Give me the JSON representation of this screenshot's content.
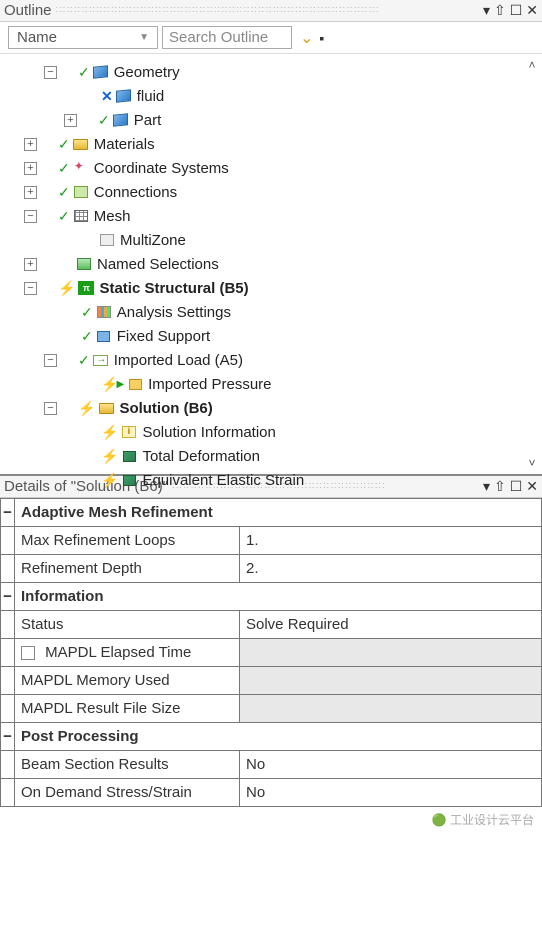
{
  "outline": {
    "title": "Outline",
    "filter_dropdown": "Name",
    "search_placeholder": "Search Outline"
  },
  "tree": {
    "geometry": "Geometry",
    "fluid": "fluid",
    "part": "Part",
    "materials": "Materials",
    "coord": "Coordinate Systems",
    "connections": "Connections",
    "mesh": "Mesh",
    "multizone": "MultiZone",
    "named": "Named Selections",
    "static": "Static Structural (B5)",
    "analysis": "Analysis Settings",
    "fixed": "Fixed Support",
    "imported_load": "Imported Load (A5)",
    "imported_pressure": "Imported Pressure",
    "solution": "Solution (B6)",
    "sol_info": "Solution Information",
    "total_def": "Total Deformation",
    "eq_strain": "Equivalent Elastic Strain"
  },
  "details": {
    "title": "Details of \"Solution (B6)\"",
    "sections": {
      "adaptive": "Adaptive Mesh Refinement",
      "info": "Information",
      "post": "Post Processing"
    },
    "rows": {
      "max_loops_label": "Max Refinement Loops",
      "max_loops_val": "1.",
      "ref_depth_label": "Refinement Depth",
      "ref_depth_val": "2.",
      "status_label": "Status",
      "status_val": "Solve Required",
      "elapsed_label": "MAPDL Elapsed Time",
      "elapsed_val": "",
      "memory_label": "MAPDL Memory Used",
      "memory_val": "",
      "result_label": "MAPDL Result File Size",
      "result_val": "",
      "beam_label": "Beam Section Results",
      "beam_val": "No",
      "demand_label": "On Demand Stress/Strain",
      "demand_val": "No"
    }
  },
  "watermark": "工业设计云平台"
}
